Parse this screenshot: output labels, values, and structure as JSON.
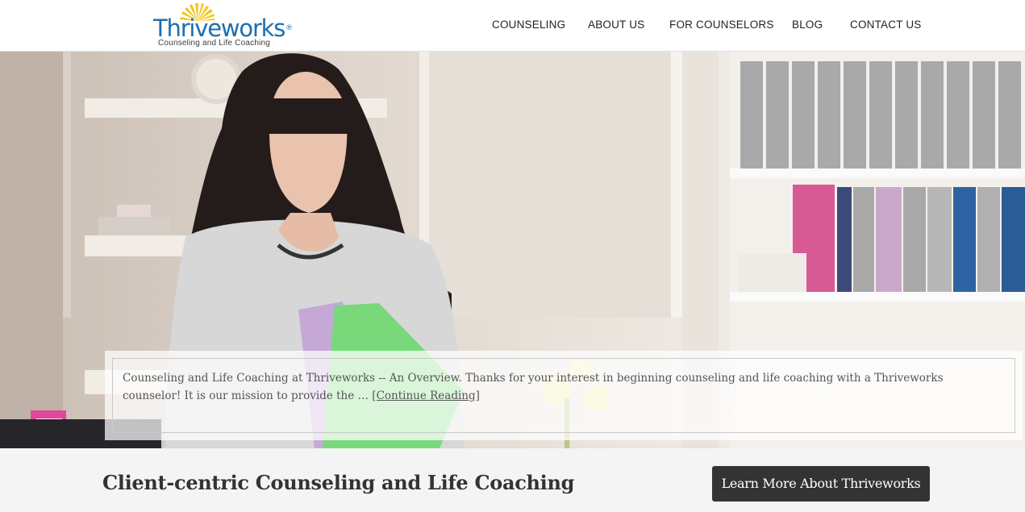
{
  "brand": {
    "name": "Thriveworks",
    "registered": "®",
    "tagline": "Counseling and Life Coaching",
    "primary_color": "#1b6fae",
    "sun_color": "#f5c518"
  },
  "nav": {
    "items": [
      {
        "label": "COUNSELING"
      },
      {
        "label": "ABOUT US"
      },
      {
        "label": "FOR COUNSELORS"
      },
      {
        "label": "BLOG"
      },
      {
        "label": "CONTACT US"
      }
    ]
  },
  "hero": {
    "image_icon": "hero-photo",
    "excerpt": "Counseling and Life Coaching at Thriveworks -- An Overview. Thanks for your interest in beginning counseling and life coaching with a Thriveworks counselor! It is our mission to provide the … ",
    "read_more": "[Continue Reading]"
  },
  "band": {
    "title": "Client-centric Counseling and Life Coaching",
    "button_label": "Learn More About Thriveworks",
    "button_color": "#333333"
  }
}
